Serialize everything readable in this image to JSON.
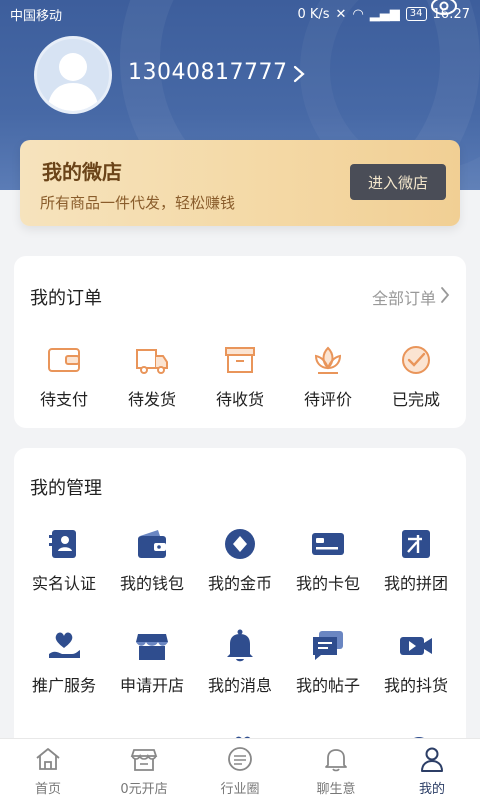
{
  "status_bar": {
    "carrier": "中国移动",
    "speed": "0 K/s",
    "battery": "34",
    "time": "16:27"
  },
  "profile": {
    "phone": "13040817777"
  },
  "store": {
    "title": "我的微店",
    "subtitle": "所有商品一件代发，轻松赚钱",
    "button": "进入微店"
  },
  "orders": {
    "title": "我的订单",
    "all_label": "全部订单",
    "items": [
      {
        "label": "待支付",
        "icon": "wallet-icon"
      },
      {
        "label": "待发货",
        "icon": "truck-icon"
      },
      {
        "label": "待收货",
        "icon": "box-icon"
      },
      {
        "label": "待评价",
        "icon": "lotus-icon"
      },
      {
        "label": "已完成",
        "icon": "check-circle-icon"
      }
    ]
  },
  "manage": {
    "title": "我的管理",
    "items": [
      {
        "label": "实名认证",
        "icon": "id-card-icon"
      },
      {
        "label": "我的钱包",
        "icon": "wallet-icon"
      },
      {
        "label": "我的金币",
        "icon": "coin-icon"
      },
      {
        "label": "我的卡包",
        "icon": "card-icon"
      },
      {
        "label": "我的拼团",
        "icon": "group-icon"
      },
      {
        "label": "推广服务",
        "icon": "heart-hand-icon"
      },
      {
        "label": "申请开店",
        "icon": "store-icon"
      },
      {
        "label": "我的消息",
        "icon": "bell-icon"
      },
      {
        "label": "我的帖子",
        "icon": "chat-icon"
      },
      {
        "label": "我的抖货",
        "icon": "video-icon"
      }
    ]
  },
  "colors": {
    "header": "#4769a6",
    "accent_orange": "#e9955a",
    "manage_blue": "#2f4d8e"
  },
  "nav": {
    "items": [
      {
        "label": "首页",
        "icon": "home-icon"
      },
      {
        "label": "0元开店",
        "icon": "shop-icon"
      },
      {
        "label": "行业圈",
        "icon": "circle-chat-icon"
      },
      {
        "label": "聊生意",
        "icon": "bell-icon"
      },
      {
        "label": "我的",
        "icon": "user-icon",
        "active": true
      }
    ]
  }
}
